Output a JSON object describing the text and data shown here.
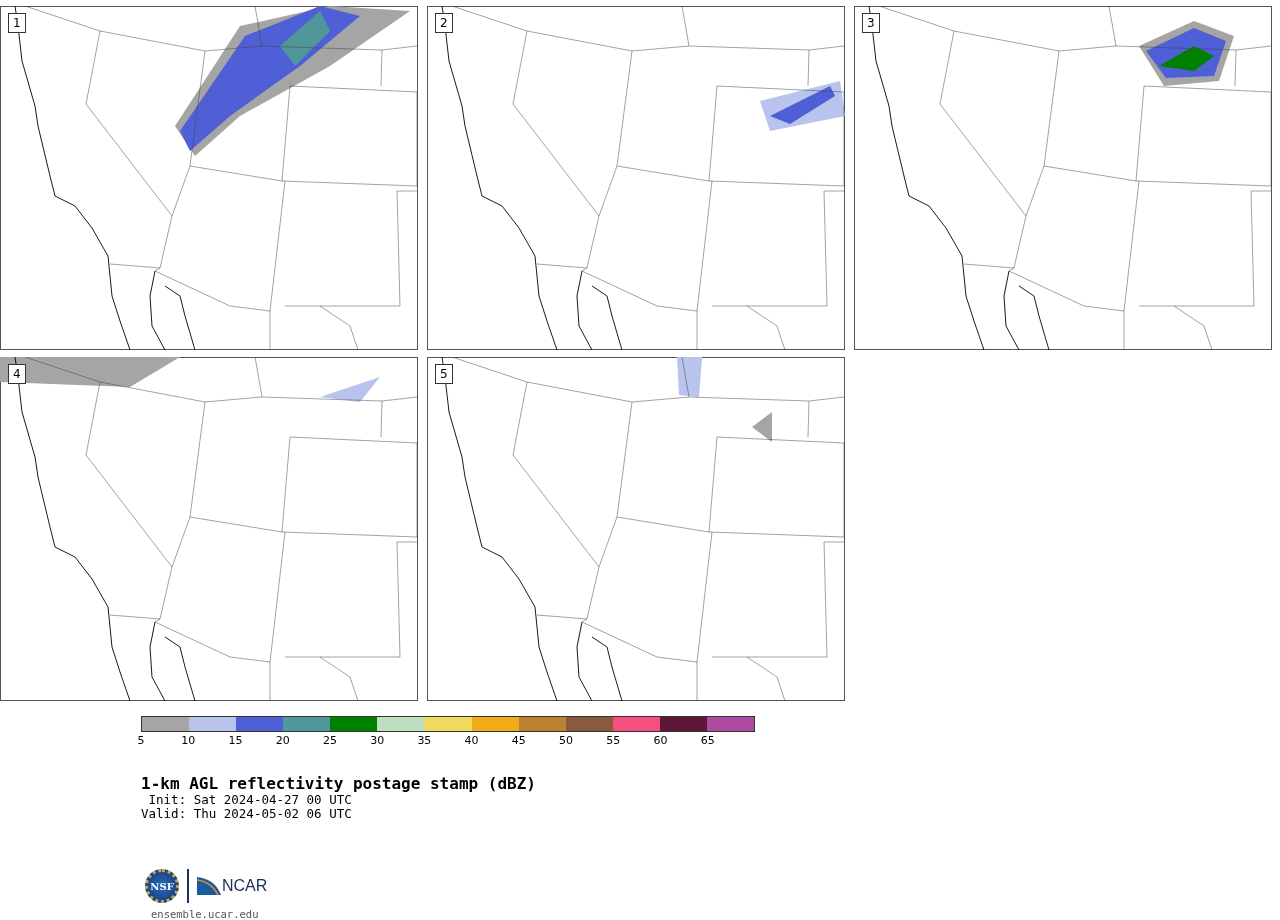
{
  "panels": [
    {
      "label": "1"
    },
    {
      "label": "2"
    },
    {
      "label": "3"
    },
    {
      "label": "4"
    },
    {
      "label": "5"
    }
  ],
  "colorbar": {
    "segments": [
      {
        "color": "#a5a5a5"
      },
      {
        "color": "#b8c3ee"
      },
      {
        "color": "#4f5fd6"
      },
      {
        "color": "#4f9799"
      },
      {
        "color": "#008000"
      },
      {
        "color": "#bfdec0"
      },
      {
        "color": "#f1db5f"
      },
      {
        "color": "#f0ab16"
      },
      {
        "color": "#bb8232"
      },
      {
        "color": "#895a40"
      },
      {
        "color": "#f54e7f"
      },
      {
        "color": "#5e1737"
      },
      {
        "color": "#ad4aa2"
      }
    ],
    "ticks": [
      "5",
      "10",
      "15",
      "20",
      "25",
      "30",
      "35",
      "40",
      "45",
      "50",
      "55",
      "60",
      "65"
    ]
  },
  "title": "1-km AGL reflectivity postage stamp (dBZ)",
  "init": " Init: Sat 2024-04-27 00 UTC",
  "valid": "Valid: Thu 2024-05-02 06 UTC",
  "logo": {
    "nsf": "NSF",
    "ncar": "NCAR"
  },
  "site": "ensemble.ucar.edu"
}
